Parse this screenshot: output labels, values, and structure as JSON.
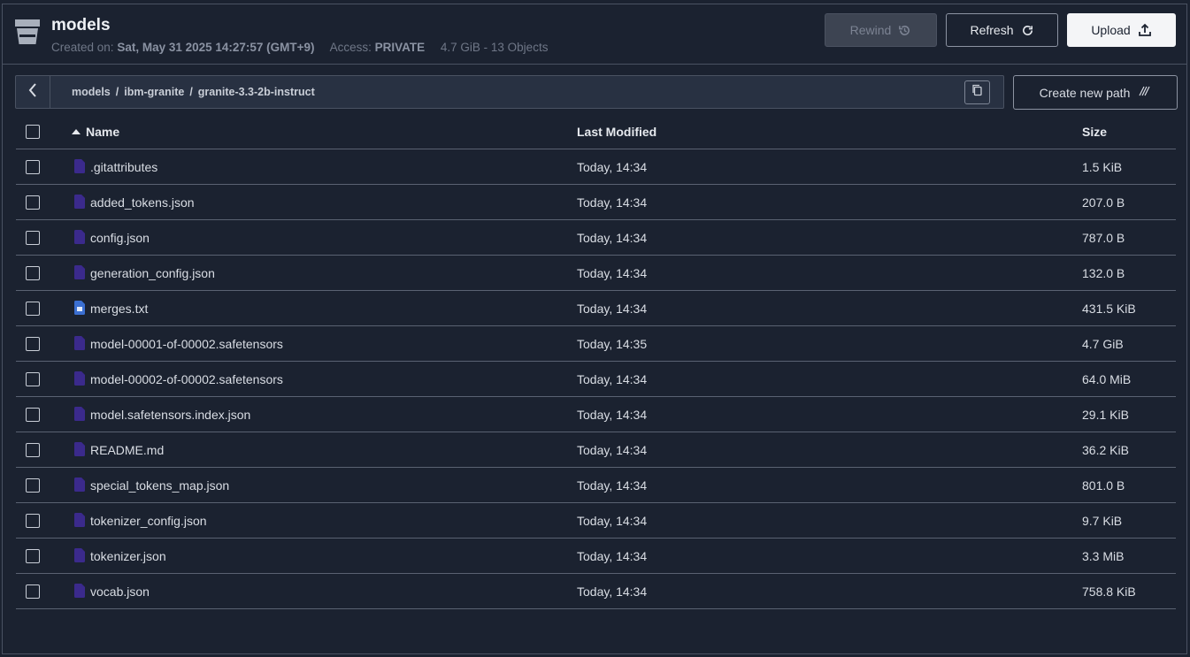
{
  "bucket": {
    "name": "models",
    "created_label": "Created on:",
    "created_value": "Sat, May 31 2025 14:27:57 (GMT+9)",
    "access_label": "Access:",
    "access_value": "PRIVATE",
    "usage": "4.7 GiB - 13 Objects"
  },
  "toolbar": {
    "rewind_label": "Rewind",
    "refresh_label": "Refresh",
    "upload_label": "Upload"
  },
  "path": {
    "crumbs": [
      "models",
      "ibm-granite",
      "granite-3.3-2b-instruct"
    ],
    "separator": "/",
    "create_label": "Create new path"
  },
  "table": {
    "headers": {
      "name": "Name",
      "modified": "Last Modified",
      "size": "Size"
    },
    "rows": [
      {
        "name": ".gitattributes",
        "modified": "Today, 14:34",
        "size": "1.5 KiB",
        "icon": "file-icon"
      },
      {
        "name": "added_tokens.json",
        "modified": "Today, 14:34",
        "size": "207.0 B",
        "icon": "file-icon"
      },
      {
        "name": "config.json",
        "modified": "Today, 14:34",
        "size": "787.0 B",
        "icon": "file-icon"
      },
      {
        "name": "generation_config.json",
        "modified": "Today, 14:34",
        "size": "132.0 B",
        "icon": "file-icon"
      },
      {
        "name": "merges.txt",
        "modified": "Today, 14:34",
        "size": "431.5 KiB",
        "icon": "text-file-icon"
      },
      {
        "name": "model-00001-of-00002.safetensors",
        "modified": "Today, 14:35",
        "size": "4.7 GiB",
        "icon": "file-icon"
      },
      {
        "name": "model-00002-of-00002.safetensors",
        "modified": "Today, 14:34",
        "size": "64.0 MiB",
        "icon": "file-icon"
      },
      {
        "name": "model.safetensors.index.json",
        "modified": "Today, 14:34",
        "size": "29.1 KiB",
        "icon": "file-icon"
      },
      {
        "name": "README.md",
        "modified": "Today, 14:34",
        "size": "36.2 KiB",
        "icon": "file-icon"
      },
      {
        "name": "special_tokens_map.json",
        "modified": "Today, 14:34",
        "size": "801.0 B",
        "icon": "file-icon"
      },
      {
        "name": "tokenizer_config.json",
        "modified": "Today, 14:34",
        "size": "9.7 KiB",
        "icon": "file-icon"
      },
      {
        "name": "tokenizer.json",
        "modified": "Today, 14:34",
        "size": "3.3 MiB",
        "icon": "file-icon"
      },
      {
        "name": "vocab.json",
        "modified": "Today, 14:34",
        "size": "758.8 KiB",
        "icon": "file-icon"
      }
    ]
  },
  "colors": {
    "background": "#1b2230",
    "file_icon": "#3b2a8c",
    "text_file_icon": "#3b6fd1"
  }
}
